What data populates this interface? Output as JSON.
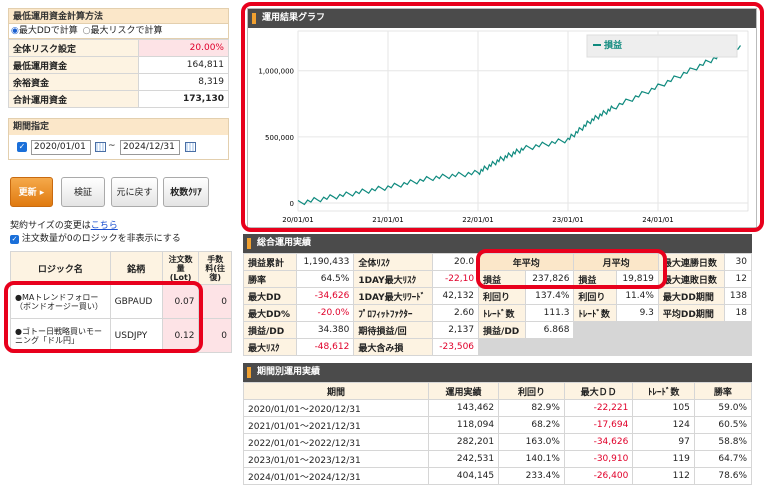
{
  "calc": {
    "title": "最低運用資金計算方法",
    "opt1": "最大DDで計算",
    "opt2": "最大リスクで計算",
    "rows": [
      {
        "label": "全体リスク設定",
        "value": "20.00%",
        "red": true
      },
      {
        "label": "最低運用資金",
        "value": "164,811"
      },
      {
        "label": "余裕資金",
        "value": "8,319"
      },
      {
        "label": "合計運用資金",
        "value": "173,130",
        "bold": true
      }
    ]
  },
  "period": {
    "title": "期間指定",
    "start": "2020/01/01",
    "tilde": "~",
    "end": "2024/12/31"
  },
  "buttons": {
    "update": "更新",
    "verify": "検証",
    "reset": "元に戻す",
    "lot_clear": "枚数ｸﾘｱ"
  },
  "contract": {
    "note": "契約サイズの変更は",
    "link": "こちら",
    "checkbox": "注文数量が0のロジックを非表示にする"
  },
  "logic_table": {
    "headers": [
      "ロジック名",
      "銘柄",
      "注文数量(Lot)",
      "手数料(往復)"
    ],
    "rows": [
      {
        "name": "●MAトレンドフォロー（ボンドオージー買い）",
        "symbol": "GBPAUD",
        "lot": "0.07",
        "fee": "0"
      },
      {
        "name": "●ゴトー日戦略買いモーニング「ドル円」",
        "symbol": "USDJPY",
        "lot": "0.12",
        "fee": "0"
      }
    ]
  },
  "graph": {
    "title": "運用結果グラフ",
    "legend": "損益",
    "yticks": [
      "1,000,000",
      "500,000",
      "0"
    ],
    "xticks": [
      "20/01/01",
      "21/01/01",
      "22/01/01",
      "23/01/01",
      "24/01/01"
    ]
  },
  "chart_data": {
    "type": "line",
    "title": "運用結果グラフ",
    "series": [
      {
        "name": "損益",
        "x": [
          "2020/01",
          "2020/07",
          "2021/01",
          "2021/07",
          "2022/01",
          "2022/04",
          "2022/07",
          "2023/01",
          "2023/04",
          "2023/07",
          "2024/01",
          "2024/07",
          "2024/12"
        ],
        "values": [
          0,
          60000,
          120000,
          190000,
          230000,
          330000,
          410000,
          480000,
          620000,
          720000,
          880000,
          1050000,
          1190433
        ]
      }
    ],
    "ylim": [
      -60000,
      1300000
    ],
    "color_line": "#0f8a7e"
  },
  "summary": {
    "title": "総合運用実績",
    "grid": [
      [
        [
          "損益累計",
          "1,190,433",
          false
        ],
        [
          "全体ﾘｽｸ",
          "20.0",
          false
        ],
        [
          "",
          "",
          false
        ],
        [
          "最大連勝日数",
          "30",
          false
        ]
      ],
      [
        [
          "勝率",
          "64.5%",
          false
        ],
        [
          "1DAY最大ﾘｽｸ",
          "-22,10",
          true
        ],
        [
          "",
          "",
          false
        ],
        [
          "最大連敗日数",
          "12",
          false
        ]
      ],
      [
        [
          "最大DD",
          "-34,626",
          true
        ],
        [
          "1DAY最大ﾘﾜｰﾄﾞ",
          "42,132",
          false
        ],
        [
          "",
          "",
          false
        ],
        [
          "最大DD期間",
          "138",
          false
        ]
      ],
      [
        [
          "最大DD%",
          "-20.0%",
          true
        ],
        [
          "ﾌﾟﾛﾌｨｯﾄﾌｧｸﾀｰ",
          "2.60",
          false
        ],
        [
          "",
          "",
          false
        ],
        [
          "平均DD期間",
          "18",
          false
        ]
      ],
      [
        [
          "損益/DD",
          "34.380",
          false
        ],
        [
          "期待損益/回",
          "2,137",
          false
        ],
        [
          "",
          "",
          false
        ],
        [
          "",
          "",
          false
        ]
      ],
      [
        [
          "最大ﾘｽｸ",
          "-48,612",
          true
        ],
        [
          "最大含み損",
          "-23,506",
          true
        ],
        [
          "",
          "",
          false
        ],
        [
          "",
          "",
          false
        ]
      ]
    ],
    "yearly_head": "年平均",
    "monthly_head": "月平均",
    "yearly": [
      [
        "損益",
        "237,826"
      ],
      [
        "利回り",
        "137.4%"
      ],
      [
        "ﾄﾚｰﾄﾞ数",
        "111.3"
      ],
      [
        "損益/DD",
        "6.868"
      ]
    ],
    "monthly": [
      [
        "損益",
        "19,819"
      ],
      [
        "利回り",
        "11.4%"
      ],
      [
        "ﾄﾚｰﾄﾞ数",
        "9.3"
      ]
    ]
  },
  "periodic": {
    "title": "期間別運用実績",
    "headers": [
      "期間",
      "運用実績",
      "利回り",
      "最大ＤＤ",
      "ﾄﾚｰﾄﾞ数",
      "勝率"
    ],
    "rows": [
      [
        "2020/01/01～2020/12/31",
        "143,462",
        "82.9%",
        "-22,221",
        "105",
        "59.0%"
      ],
      [
        "2021/01/01～2021/12/31",
        "118,094",
        "68.2%",
        "-17,694",
        "124",
        "60.5%"
      ],
      [
        "2022/01/01～2022/12/31",
        "282,201",
        "163.0%",
        "-34,626",
        "97",
        "58.8%"
      ],
      [
        "2023/01/01～2023/12/31",
        "242,531",
        "140.1%",
        "-30,910",
        "119",
        "64.7%"
      ],
      [
        "2024/01/01～2024/12/31",
        "404,145",
        "233.4%",
        "-26,400",
        "112",
        "78.6%"
      ]
    ]
  }
}
